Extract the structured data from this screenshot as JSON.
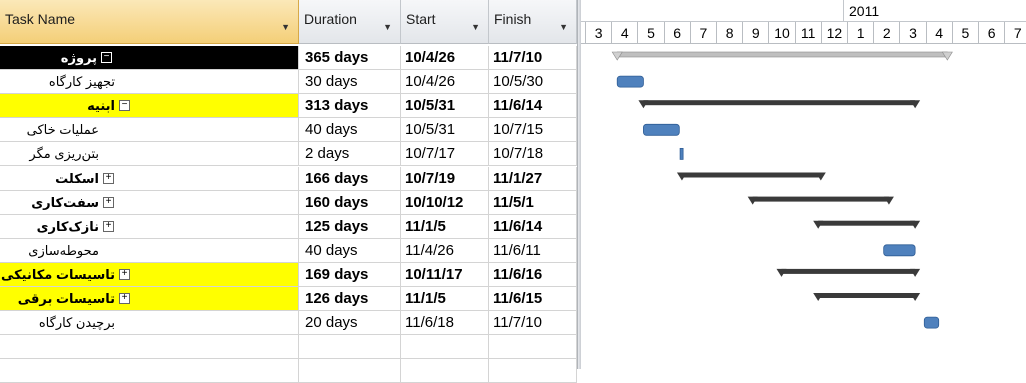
{
  "columns": {
    "task_name": "Task Name",
    "duration": "Duration",
    "start": "Start",
    "finish": "Finish"
  },
  "timescale": {
    "year": "2011",
    "months": [
      "3",
      "4",
      "5",
      "6",
      "7",
      "8",
      "9",
      "10",
      "11",
      "12",
      "1",
      "2",
      "3",
      "4",
      "5",
      "6",
      "7"
    ]
  },
  "tasks": [
    {
      "name": "پروژه",
      "duration": "365 days",
      "start": "10/4/26",
      "finish": "11/7/10",
      "summary": true,
      "level": 0,
      "toggle": "minus",
      "highlight": "black",
      "bar": {
        "type": "project",
        "s": 1.23,
        "e": 13.83
      }
    },
    {
      "name": "تجهیز کارگاه",
      "duration": "30 days",
      "start": "10/4/26",
      "finish": "10/5/30",
      "summary": false,
      "level": 1,
      "toggle": "",
      "highlight": "",
      "bar": {
        "type": "task",
        "s": 1.23,
        "e": 2.23
      }
    },
    {
      "name": "ابنیه",
      "duration": "313 days",
      "start": "10/5/31",
      "finish": "11/6/14",
      "summary": true,
      "level": 1,
      "toggle": "minus",
      "highlight": "yellow",
      "bar": {
        "type": "summary",
        "s": 2.23,
        "e": 12.6
      }
    },
    {
      "name": "عملیات خاکی",
      "duration": "40 days",
      "start": "10/5/31",
      "finish": "10/7/15",
      "summary": false,
      "level": 2,
      "toggle": "",
      "highlight": "",
      "bar": {
        "type": "task",
        "s": 2.23,
        "e": 3.6
      }
    },
    {
      "name": "بتن‌ریزی مگر",
      "duration": "2 days",
      "start": "10/7/17",
      "finish": "10/7/18",
      "summary": false,
      "level": 2,
      "toggle": "",
      "highlight": "",
      "bar": {
        "type": "task",
        "s": 3.63,
        "e": 3.7
      }
    },
    {
      "name": "اسکلت",
      "duration": "166 days",
      "start": "10/7/19",
      "finish": "11/1/27",
      "summary": true,
      "level": 2,
      "toggle": "plus",
      "highlight": "",
      "bar": {
        "type": "summary",
        "s": 3.7,
        "e": 9.0
      }
    },
    {
      "name": "سفت‌کاری",
      "duration": "160 days",
      "start": "10/10/12",
      "finish": "11/5/1",
      "summary": true,
      "level": 2,
      "toggle": "plus",
      "highlight": "",
      "bar": {
        "type": "summary",
        "s": 6.4,
        "e": 11.6
      }
    },
    {
      "name": "نازک‌کاری",
      "duration": "125 days",
      "start": "11/1/5",
      "finish": "11/6/14",
      "summary": true,
      "level": 2,
      "toggle": "plus",
      "highlight": "",
      "bar": {
        "type": "summary",
        "s": 8.9,
        "e": 12.6
      }
    },
    {
      "name": "محوطه‌سازی",
      "duration": "40 days",
      "start": "11/4/26",
      "finish": "11/6/11",
      "summary": false,
      "level": 2,
      "toggle": "",
      "highlight": "",
      "bar": {
        "type": "task",
        "s": 11.4,
        "e": 12.6
      }
    },
    {
      "name": "تاسیسات مکانیکی",
      "duration": "169 days",
      "start": "10/11/17",
      "finish": "11/6/16",
      "summary": true,
      "level": 1,
      "toggle": "plus",
      "highlight": "yellow",
      "bar": {
        "type": "summary",
        "s": 7.5,
        "e": 12.6
      }
    },
    {
      "name": "تاسیسات برقی",
      "duration": "126 days",
      "start": "11/1/5",
      "finish": "11/6/15",
      "summary": true,
      "level": 1,
      "toggle": "plus",
      "highlight": "yellow",
      "bar": {
        "type": "summary",
        "s": 8.9,
        "e": 12.6
      }
    },
    {
      "name": "برچیدن کارگاه",
      "duration": "20 days",
      "start": "11/6/18",
      "finish": "11/7/10",
      "summary": false,
      "level": 1,
      "toggle": "",
      "highlight": "",
      "bar": {
        "type": "task",
        "s": 12.95,
        "e": 13.5
      }
    }
  ],
  "colors": {
    "task_bar": "#4f81bd",
    "summary_bar": "#3a3a3a",
    "project_bar": "#bfbfbf",
    "highlight": "#ffff00"
  }
}
